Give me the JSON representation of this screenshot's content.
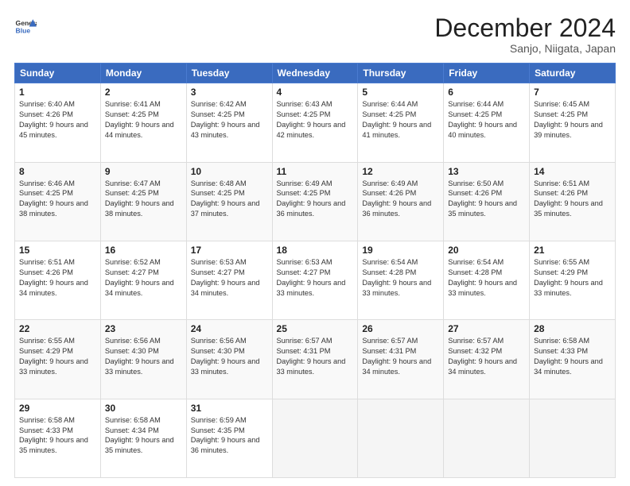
{
  "logo": {
    "line1": "General",
    "line2": "Blue"
  },
  "title": "December 2024",
  "subtitle": "Sanjo, Niigata, Japan",
  "days_of_week": [
    "Sunday",
    "Monday",
    "Tuesday",
    "Wednesday",
    "Thursday",
    "Friday",
    "Saturday"
  ],
  "weeks": [
    [
      {
        "day": 1,
        "sunrise": "6:40 AM",
        "sunset": "4:26 PM",
        "daylight": "9 hours and 45 minutes."
      },
      {
        "day": 2,
        "sunrise": "6:41 AM",
        "sunset": "4:25 PM",
        "daylight": "9 hours and 44 minutes."
      },
      {
        "day": 3,
        "sunrise": "6:42 AM",
        "sunset": "4:25 PM",
        "daylight": "9 hours and 43 minutes."
      },
      {
        "day": 4,
        "sunrise": "6:43 AM",
        "sunset": "4:25 PM",
        "daylight": "9 hours and 42 minutes."
      },
      {
        "day": 5,
        "sunrise": "6:44 AM",
        "sunset": "4:25 PM",
        "daylight": "9 hours and 41 minutes."
      },
      {
        "day": 6,
        "sunrise": "6:44 AM",
        "sunset": "4:25 PM",
        "daylight": "9 hours and 40 minutes."
      },
      {
        "day": 7,
        "sunrise": "6:45 AM",
        "sunset": "4:25 PM",
        "daylight": "9 hours and 39 minutes."
      }
    ],
    [
      {
        "day": 8,
        "sunrise": "6:46 AM",
        "sunset": "4:25 PM",
        "daylight": "9 hours and 38 minutes."
      },
      {
        "day": 9,
        "sunrise": "6:47 AM",
        "sunset": "4:25 PM",
        "daylight": "9 hours and 38 minutes."
      },
      {
        "day": 10,
        "sunrise": "6:48 AM",
        "sunset": "4:25 PM",
        "daylight": "9 hours and 37 minutes."
      },
      {
        "day": 11,
        "sunrise": "6:49 AM",
        "sunset": "4:25 PM",
        "daylight": "9 hours and 36 minutes."
      },
      {
        "day": 12,
        "sunrise": "6:49 AM",
        "sunset": "4:26 PM",
        "daylight": "9 hours and 36 minutes."
      },
      {
        "day": 13,
        "sunrise": "6:50 AM",
        "sunset": "4:26 PM",
        "daylight": "9 hours and 35 minutes."
      },
      {
        "day": 14,
        "sunrise": "6:51 AM",
        "sunset": "4:26 PM",
        "daylight": "9 hours and 35 minutes."
      }
    ],
    [
      {
        "day": 15,
        "sunrise": "6:51 AM",
        "sunset": "4:26 PM",
        "daylight": "9 hours and 34 minutes."
      },
      {
        "day": 16,
        "sunrise": "6:52 AM",
        "sunset": "4:27 PM",
        "daylight": "9 hours and 34 minutes."
      },
      {
        "day": 17,
        "sunrise": "6:53 AM",
        "sunset": "4:27 PM",
        "daylight": "9 hours and 34 minutes."
      },
      {
        "day": 18,
        "sunrise": "6:53 AM",
        "sunset": "4:27 PM",
        "daylight": "9 hours and 33 minutes."
      },
      {
        "day": 19,
        "sunrise": "6:54 AM",
        "sunset": "4:28 PM",
        "daylight": "9 hours and 33 minutes."
      },
      {
        "day": 20,
        "sunrise": "6:54 AM",
        "sunset": "4:28 PM",
        "daylight": "9 hours and 33 minutes."
      },
      {
        "day": 21,
        "sunrise": "6:55 AM",
        "sunset": "4:29 PM",
        "daylight": "9 hours and 33 minutes."
      }
    ],
    [
      {
        "day": 22,
        "sunrise": "6:55 AM",
        "sunset": "4:29 PM",
        "daylight": "9 hours and 33 minutes."
      },
      {
        "day": 23,
        "sunrise": "6:56 AM",
        "sunset": "4:30 PM",
        "daylight": "9 hours and 33 minutes."
      },
      {
        "day": 24,
        "sunrise": "6:56 AM",
        "sunset": "4:30 PM",
        "daylight": "9 hours and 33 minutes."
      },
      {
        "day": 25,
        "sunrise": "6:57 AM",
        "sunset": "4:31 PM",
        "daylight": "9 hours and 33 minutes."
      },
      {
        "day": 26,
        "sunrise": "6:57 AM",
        "sunset": "4:31 PM",
        "daylight": "9 hours and 34 minutes."
      },
      {
        "day": 27,
        "sunrise": "6:57 AM",
        "sunset": "4:32 PM",
        "daylight": "9 hours and 34 minutes."
      },
      {
        "day": 28,
        "sunrise": "6:58 AM",
        "sunset": "4:33 PM",
        "daylight": "9 hours and 34 minutes."
      }
    ],
    [
      {
        "day": 29,
        "sunrise": "6:58 AM",
        "sunset": "4:33 PM",
        "daylight": "9 hours and 35 minutes."
      },
      {
        "day": 30,
        "sunrise": "6:58 AM",
        "sunset": "4:34 PM",
        "daylight": "9 hours and 35 minutes."
      },
      {
        "day": 31,
        "sunrise": "6:59 AM",
        "sunset": "4:35 PM",
        "daylight": "9 hours and 36 minutes."
      },
      null,
      null,
      null,
      null
    ]
  ],
  "labels": {
    "sunrise": "Sunrise:",
    "sunset": "Sunset:",
    "daylight": "Daylight:"
  }
}
